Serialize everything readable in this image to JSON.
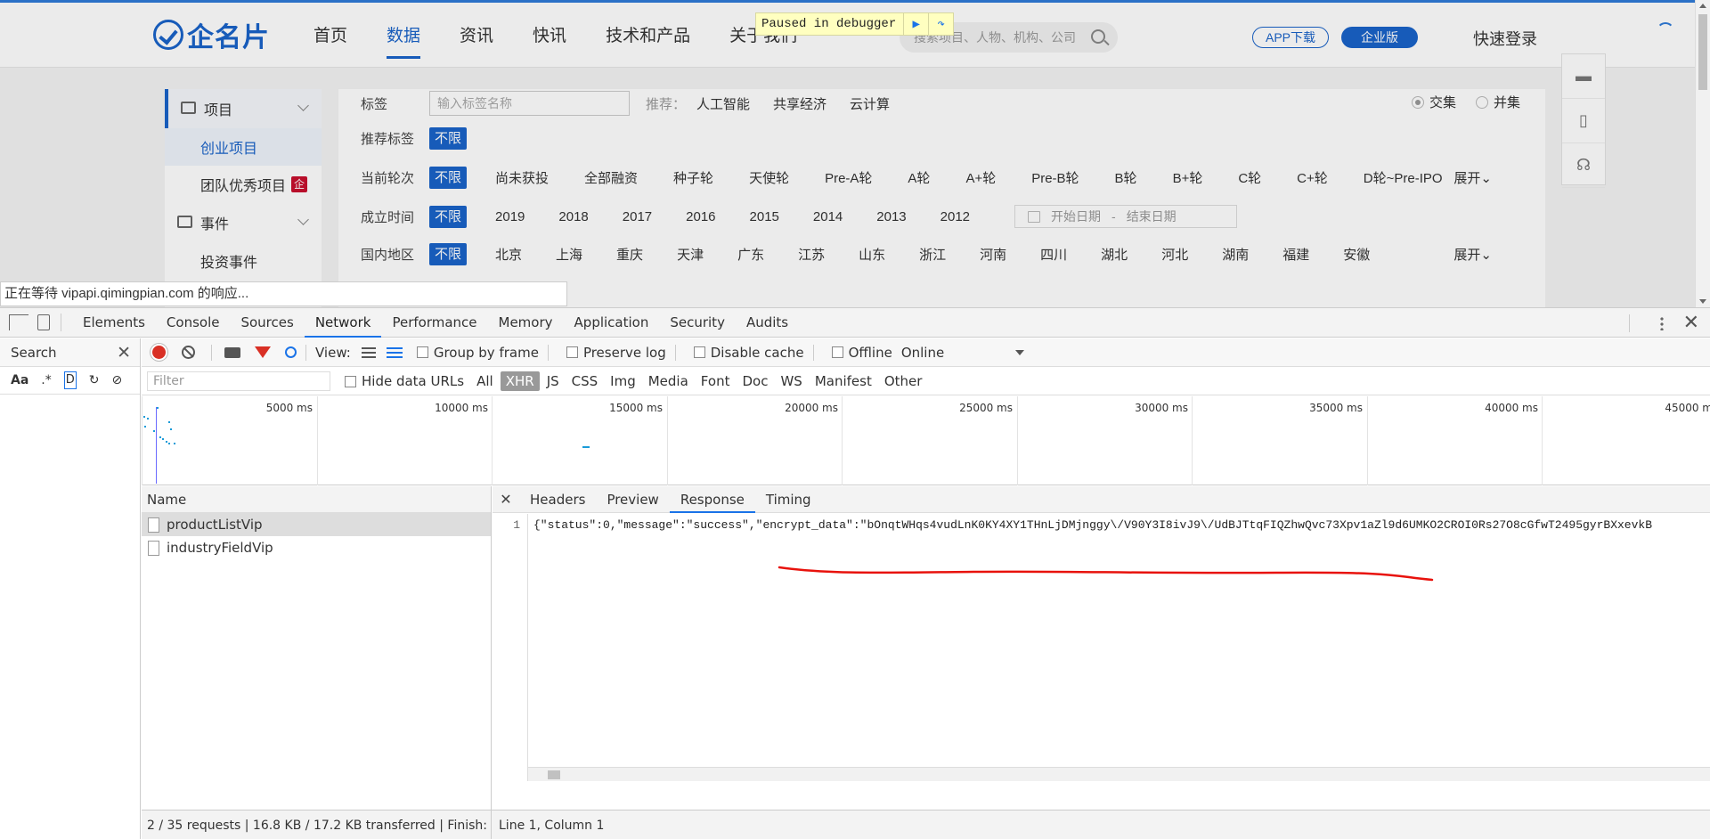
{
  "site": {
    "logo_text": "企名片",
    "nav": [
      "首页",
      "数据",
      "资讯",
      "快讯",
      "技术和产品",
      "关于我们"
    ],
    "nav_active_index": 1,
    "debugger_banner": "Paused in debugger",
    "search_placeholder": "搜索项目、人物、机构、公司",
    "app_download": "APP下载",
    "enterprise": "企业版",
    "login": "快速登录",
    "loading_status": "正在等待 vipapi.qimingpian.com 的响应..."
  },
  "sidebar": {
    "sections": [
      {
        "label": "项目",
        "items": [
          "创业项目",
          "团队优秀项目"
        ],
        "active_item": "创业项目",
        "badge": "企"
      },
      {
        "label": "事件",
        "items": [
          "投资事件"
        ]
      }
    ]
  },
  "filters": {
    "tag_label": "标签",
    "tag_placeholder": "输入标签名称",
    "recommend_prefix": "推荐：",
    "recommend_tags": [
      "人工智能",
      "共享经济",
      "云计算"
    ],
    "mode_options": [
      "交集",
      "并集"
    ],
    "mode_selected": "交集",
    "recommend_label": "推荐标签",
    "unlimited": "不限",
    "round_label": "当前轮次",
    "rounds": [
      "尚未获投",
      "全部融资",
      "种子轮",
      "天使轮",
      "Pre-A轮",
      "A轮",
      "A+轮",
      "Pre-B轮",
      "B轮",
      "B+轮",
      "C轮",
      "C+轮",
      "D轮~Pre-IPO"
    ],
    "expand": "展开",
    "time_label": "成立时间",
    "years": [
      "2019",
      "2018",
      "2017",
      "2016",
      "2015",
      "2014",
      "2013",
      "2012"
    ],
    "date_start": "开始日期",
    "date_sep": "-",
    "date_end": "结束日期",
    "region_label": "国内地区",
    "regions": [
      "北京",
      "上海",
      "重庆",
      "天津",
      "广东",
      "江苏",
      "山东",
      "浙江",
      "河南",
      "四川",
      "湖北",
      "河北",
      "湖南",
      "福建",
      "安徽"
    ]
  },
  "devtools": {
    "tabs": [
      "Elements",
      "Console",
      "Sources",
      "Network",
      "Performance",
      "Memory",
      "Application",
      "Security",
      "Audits"
    ],
    "active_tab": "Network",
    "search_label": "Search",
    "search_opts": [
      "Aa",
      ".*",
      "D"
    ],
    "toolbar": {
      "view_label": "View:",
      "group_by_frame": "Group by frame",
      "preserve_log": "Preserve log",
      "disable_cache": "Disable cache",
      "offline": "Offline",
      "throttle": "Online"
    },
    "filter": {
      "placeholder": "Filter",
      "hide_data_urls": "Hide data URLs",
      "types": [
        "All",
        "XHR",
        "JS",
        "CSS",
        "Img",
        "Media",
        "Font",
        "Doc",
        "WS",
        "Manifest",
        "Other"
      ],
      "active_type": "XHR"
    },
    "timeline_labels": [
      "5000 ms",
      "10000 ms",
      "15000 ms",
      "20000 ms",
      "25000 ms",
      "30000 ms",
      "35000 ms",
      "40000 ms",
      "45000 m"
    ],
    "requests_header": "Name",
    "requests": [
      "productListVip",
      "industryFieldVip"
    ],
    "selected_request": "productListVip",
    "detail_tabs": [
      "Headers",
      "Preview",
      "Response",
      "Timing"
    ],
    "active_detail_tab": "Response",
    "response_line_no": "1",
    "response_text": "{\"status\":0,\"message\":\"success\",\"encrypt_data\":\"bOnqtWHqs4vudLnK0KY4XY1THnLjDMjnggy\\/V90Y3I8ivJ9\\/UdBJTtqFIQZhwQvc73Xpv1aZl9d6UMKO2CROI0Rs27O8cGfwT2495gyrBXxevkB",
    "status_left": "2 / 35 requests  |  16.8 KB / 17.2 KB transferred  |  Finish: ...",
    "status_right": "Line 1, Column 1"
  }
}
